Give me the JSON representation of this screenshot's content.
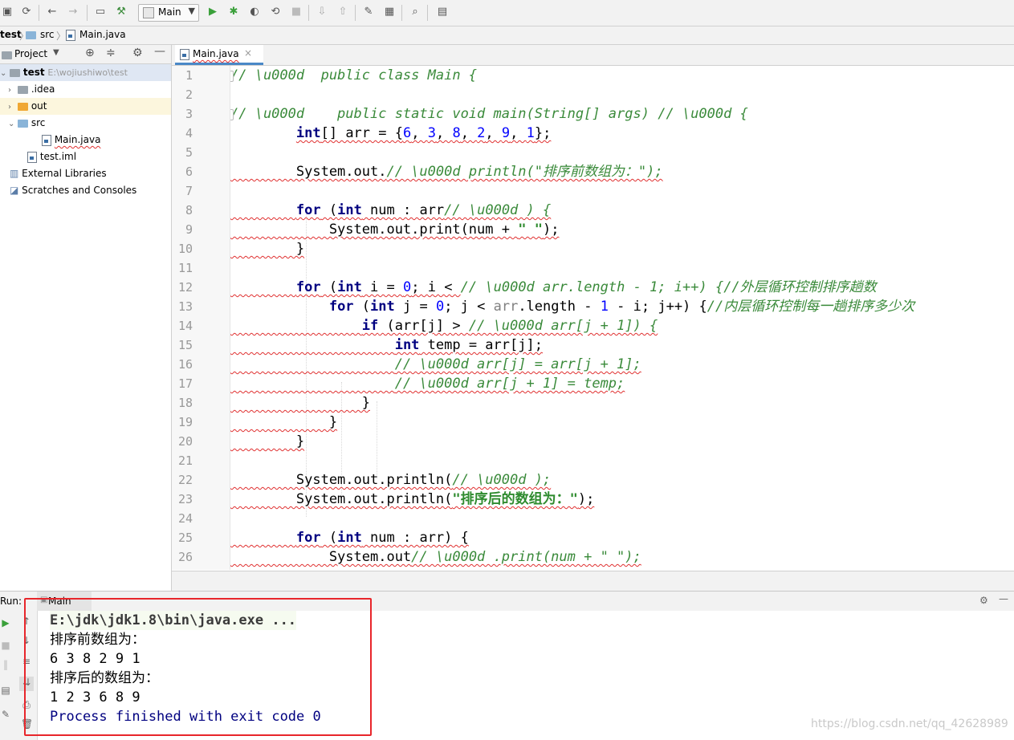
{
  "toolbar": {
    "run_config": "Main"
  },
  "breadcrumb": {
    "project": "test",
    "folder": "src",
    "file": "Main.java"
  },
  "project_panel": {
    "title": "Project",
    "root": {
      "name": "test",
      "path": "E:\\wojiushiwo\\test"
    },
    "items": [
      ".idea",
      "out",
      "src",
      "Main.java",
      "test.iml",
      "External Libraries",
      "Scratches and Consoles"
    ]
  },
  "editor": {
    "tab": "Main.java",
    "line_numbers": [
      "1",
      "2",
      "3",
      "4",
      "5",
      "6",
      "7",
      "8",
      "9",
      "10",
      "11",
      "12",
      "13",
      "14",
      "15",
      "16",
      "17",
      "18",
      "19",
      "20",
      "21",
      "22",
      "23",
      "24",
      "25",
      "26"
    ],
    "highlight_line": 14
  },
  "run": {
    "label": "Run:",
    "tab": "Main",
    "output": [
      "E:\\jdk\\jdk1.8\\bin\\java.exe ...",
      "排序前数组为：",
      "6 3 8 2 9 1",
      "排序后的数组为：",
      "1 2 3 6 8 9",
      "Process finished with exit code 0"
    ]
  },
  "watermark": "https://blog.csdn.net/qq_42628989"
}
